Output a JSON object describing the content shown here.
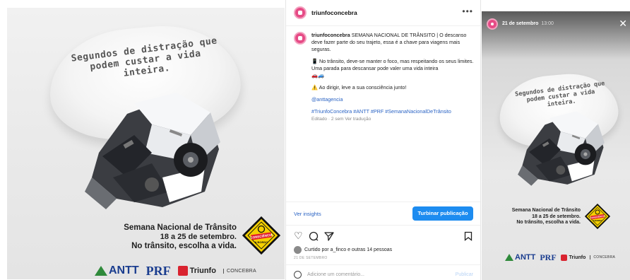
{
  "poster": {
    "headline_line1": "Segundos de distração que",
    "headline_line2": "podem custar a vida inteira.",
    "caption_line1": "Semana Nacional de Trânsito",
    "caption_line2": "18 a 25 de setembro.",
    "caption_line3": "No trânsito, escolha a vida.",
    "badge_text": "CONSCIÊNCIA A BORDO",
    "logo_antt": "ANTT",
    "logo_prf": "PRF",
    "logo_triunfo": "Triunfo",
    "logo_concebra": "CONCEBRA"
  },
  "post": {
    "username": "triunfoconcebra",
    "more_icon": "more-horizontal-icon",
    "caption_user": "triunfoconcebra",
    "caption_p1": "SEMANA NACIONAL DE TRÂNSITO | O descanso deve fazer parte do seu trajeto, essa é a chave para viagens mais seguras.",
    "caption_p2": "No trânsito, deve-se manter o foco, mas respeitando os seus limites. Uma parada para descansar pode valer uma vida inteira",
    "caption_p3": "Ao dirigir, leve a sua consciência junto!",
    "mention": "@anttagencia",
    "hashtags": "#TriunfoConcebra #ANTT #PRF #SemanaNacionalDeTrânsito",
    "meta": "Editado · 2 sem   Ver tradução",
    "insights_label": "Ver insights",
    "boost_label": "Turbinar publicação",
    "liked_by": "Curtido por a_finco e outras 14 pessoas",
    "date": "21 DE SETEMBRO",
    "comment_placeholder": "Adicione um comentário...",
    "publish_label": "Publicar"
  },
  "story": {
    "date": "21 de setembro",
    "time": "13:00",
    "close_icon": "close-icon"
  },
  "colors": {
    "accent_blue": "#1d8cf0",
    "link_blue": "#2a63c4",
    "brand_pink": "#e64b86",
    "badge_yellow": "#f5d000"
  }
}
